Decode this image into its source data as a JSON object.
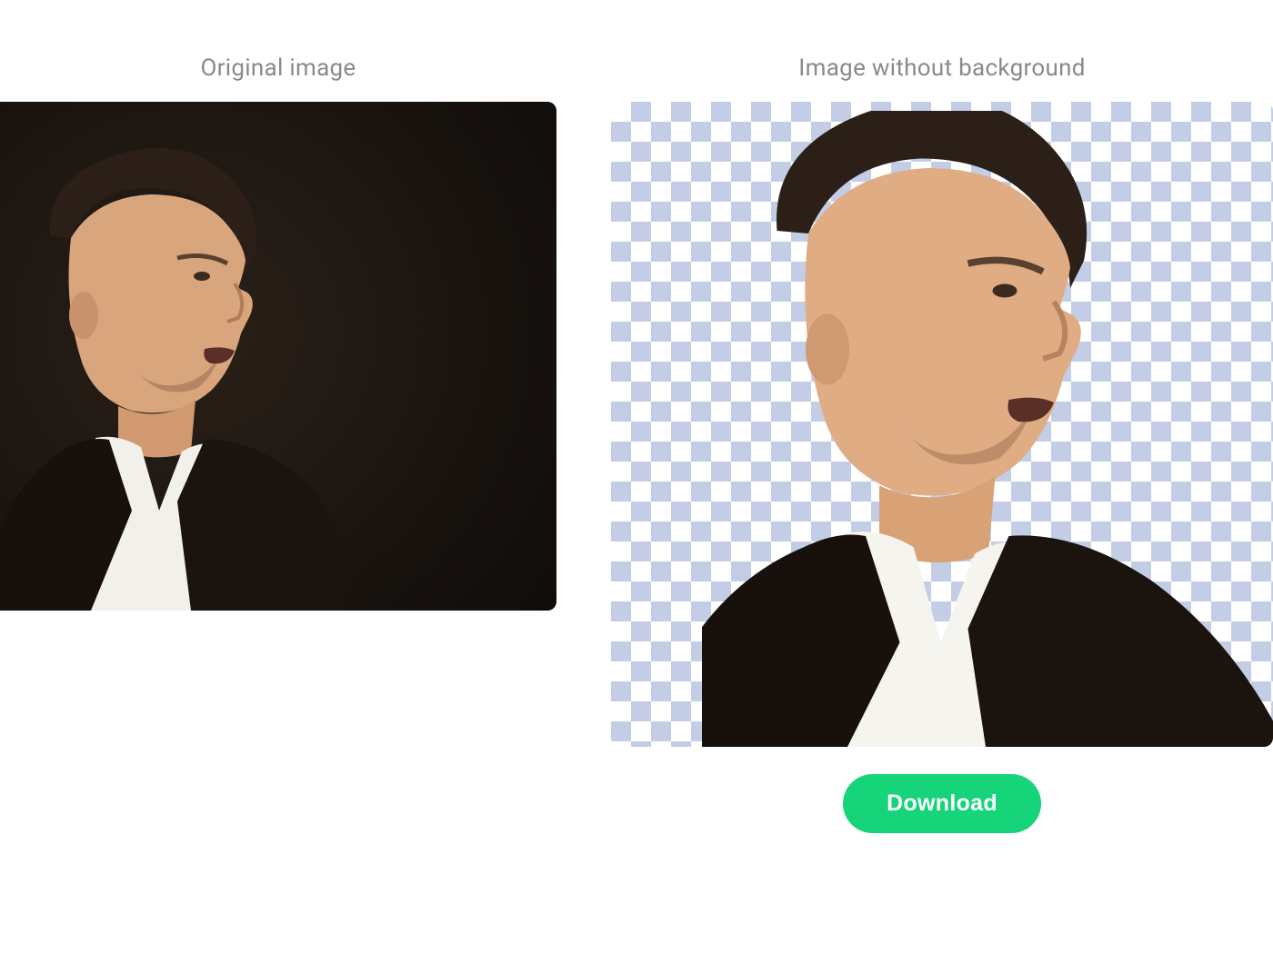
{
  "panels": {
    "original": {
      "label": "Original image"
    },
    "result": {
      "label": "Image without background"
    }
  },
  "actions": {
    "download_label": "Download"
  },
  "colors": {
    "accent": "#15d47a",
    "label_text": "#8a8a8a",
    "checker_light": "#ffffff",
    "checker_dark": "#c3cee6"
  }
}
